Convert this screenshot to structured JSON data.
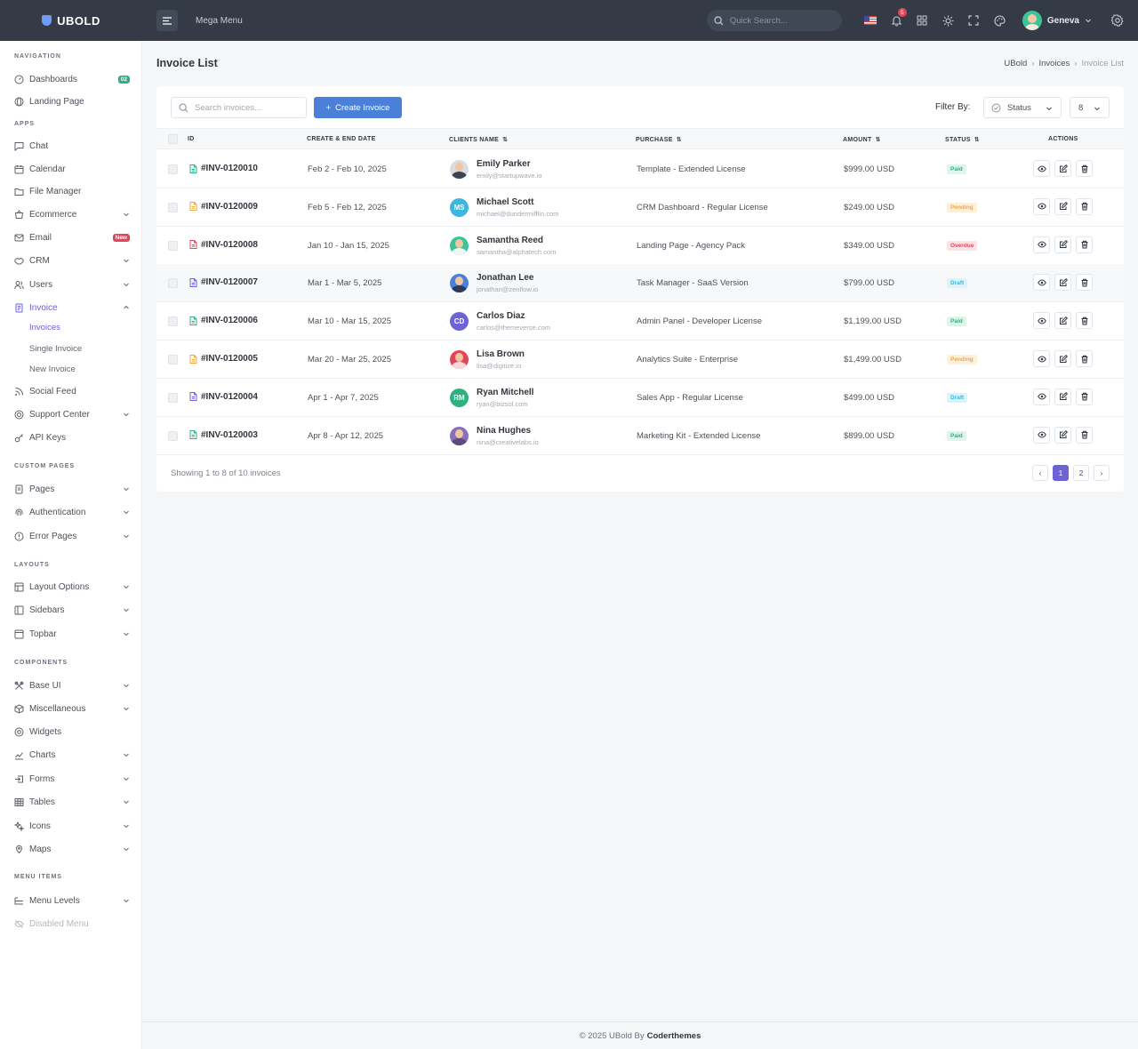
{
  "brand": {
    "name": "UBOLD"
  },
  "topbar": {
    "mega_menu": "Mega Menu",
    "search_placeholder": "Quick Search...",
    "notification_count": "5",
    "user_name": "Geneva"
  },
  "sidebar": {
    "sections": {
      "navigation": "NAVIGATION",
      "apps": "APPS",
      "custom_pages": "CUSTOM PAGES",
      "layouts": "LAYOUTS",
      "components": "COMPONENTS",
      "menu_items": "MENU ITEMS"
    },
    "items": {
      "dashboards": "Dashboards",
      "dashboards_badge": "02",
      "landing": "Landing Page",
      "chat": "Chat",
      "calendar": "Calendar",
      "file_manager": "File Manager",
      "ecommerce": "Ecommerce",
      "email": "Email",
      "email_badge": "New",
      "crm": "CRM",
      "users": "Users",
      "invoice": "Invoice",
      "invoices": "Invoices",
      "single_invoice": "Single Invoice",
      "new_invoice": "New Invoice",
      "social_feed": "Social Feed",
      "support_center": "Support Center",
      "api_keys": "API Keys",
      "pages": "Pages",
      "authentication": "Authentication",
      "error_pages": "Error Pages",
      "layout_options": "Layout Options",
      "sidebars": "Sidebars",
      "topbar": "Topbar",
      "base_ui": "Base UI",
      "misc": "Miscellaneous",
      "widgets": "Widgets",
      "charts": "Charts",
      "forms": "Forms",
      "tables": "Tables",
      "icons": "Icons",
      "maps": "Maps",
      "menu_levels": "Menu Levels",
      "disabled_menu": "Disabled Menu"
    }
  },
  "page": {
    "title": "Invoice List",
    "breadcrumb": [
      "UBold",
      "Invoices",
      "Invoice List"
    ]
  },
  "toolbar": {
    "search_placeholder": "Search invoices...",
    "create_label": "Create Invoice",
    "filter_label": "Filter By:",
    "status_select": "Status",
    "count_select": "8"
  },
  "table": {
    "headers": {
      "id": "ID",
      "dates": "CREATE & END DATE",
      "client": "CLIENTS NAME",
      "purchase": "PURCHASE",
      "amount": "AMOUNT",
      "status": "STATUS",
      "actions": "ACTIONS"
    },
    "rows": [
      {
        "id": "#INV-0120010",
        "dates": "Feb 2 - Feb 10, 2025",
        "name": "Emily Parker",
        "email": "emily@startupwave.io",
        "purchase": "Template - Extended License",
        "amount": "$999.00 USD",
        "status": "Paid"
      },
      {
        "id": "#INV-0120009",
        "dates": "Feb 5 - Feb 12, 2025",
        "name": "Michael Scott",
        "email": "michael@dundermifflin.com",
        "initials": "MS",
        "purchase": "CRM Dashboard - Regular License",
        "amount": "$249.00 USD",
        "status": "Pending"
      },
      {
        "id": "#INV-0120008",
        "dates": "Jan 10 - Jan 15, 2025",
        "name": "Samantha Reed",
        "email": "samantha@alphatech.com",
        "purchase": "Landing Page - Agency Pack",
        "amount": "$349.00 USD",
        "status": "Overdue"
      },
      {
        "id": "#INV-0120007",
        "dates": "Mar 1 - Mar 5, 2025",
        "name": "Jonathan Lee",
        "email": "jonathan@zenflow.io",
        "purchase": "Task Manager - SaaS Version",
        "amount": "$799.00 USD",
        "status": "Draft"
      },
      {
        "id": "#INV-0120006",
        "dates": "Mar 10 - Mar 15, 2025",
        "name": "Carlos Diaz",
        "email": "carlos@themeverse.com",
        "initials": "CD",
        "purchase": "Admin Panel - Developer License",
        "amount": "$1,199.00 USD",
        "status": "Paid"
      },
      {
        "id": "#INV-0120005",
        "dates": "Mar 20 - Mar 25, 2025",
        "name": "Lisa Brown",
        "email": "lisa@digitize.io",
        "purchase": "Analytics Suite - Enterprise",
        "amount": "$1,499.00 USD",
        "status": "Pending"
      },
      {
        "id": "#INV-0120004",
        "dates": "Apr 1 - Apr 7, 2025",
        "name": "Ryan Mitchell",
        "email": "ryan@bizsol.com",
        "initials": "RM",
        "purchase": "Sales App - Regular License",
        "amount": "$499.00 USD",
        "status": "Draft"
      },
      {
        "id": "#INV-0120003",
        "dates": "Apr 8 - Apr 12, 2025",
        "name": "Nina Hughes",
        "email": "nina@creativelabs.io",
        "purchase": "Marketing Kit - Extended License",
        "amount": "$899.00 USD",
        "status": "Paid"
      }
    ]
  },
  "pagination": {
    "showing_prefix": "Showing ",
    "from": "1",
    "to_word": " to ",
    "to": "8",
    "of_word": " of ",
    "total": "10",
    "suffix": " invoices",
    "pages": [
      "1",
      "2"
    ]
  },
  "footer": {
    "text": "© 2025 UBold By",
    "author": "Coderthemes"
  },
  "colors": {
    "topbar": "#343a46",
    "accent": "#6d63d4",
    "primary_button": "#4a80d8",
    "paid": "#2bb27f",
    "pending": "#f0a93b",
    "overdue": "#e0475b",
    "draft": "#3bb7e0"
  }
}
